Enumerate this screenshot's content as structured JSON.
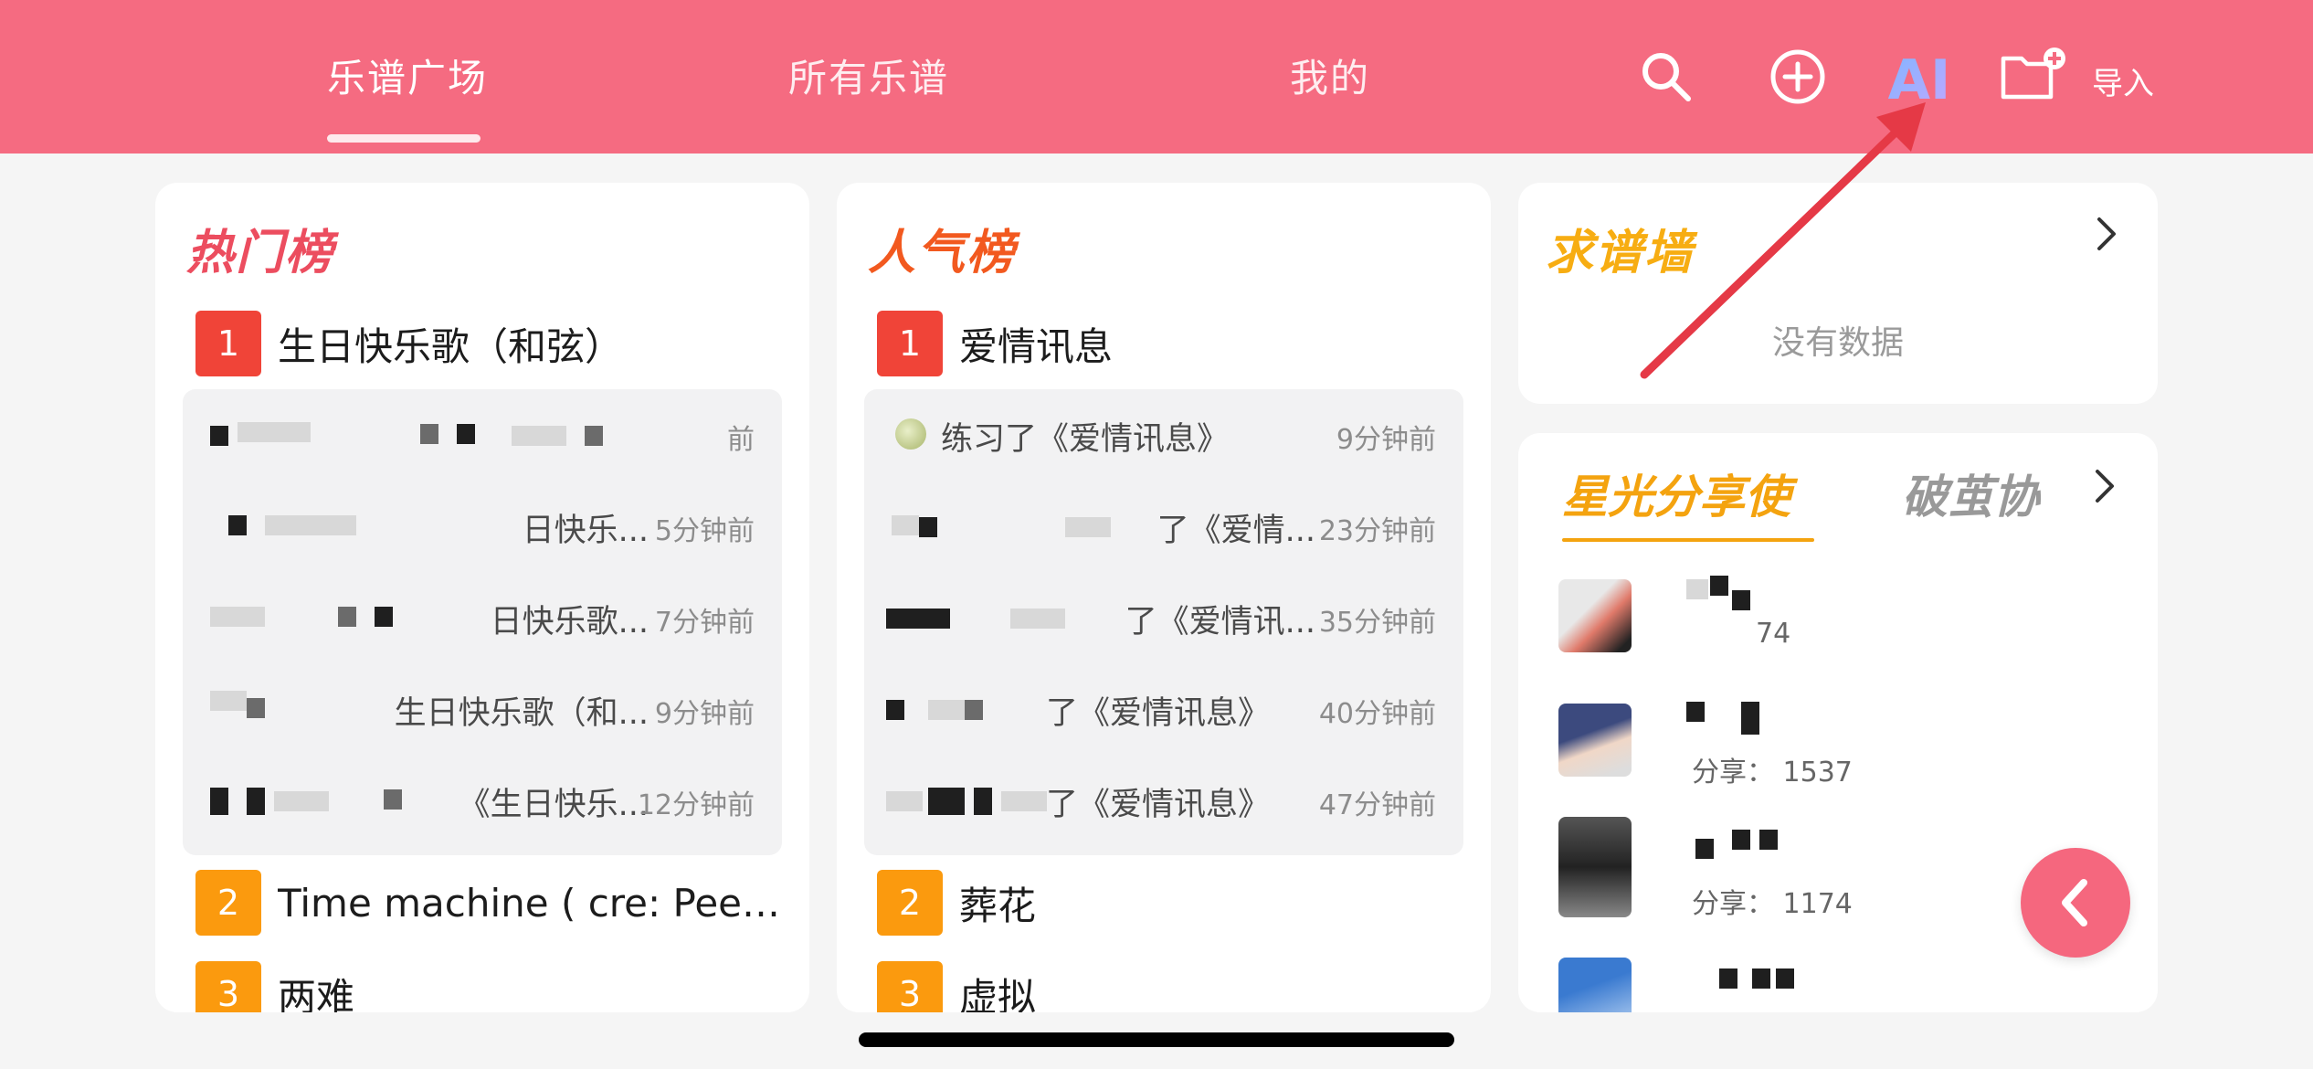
{
  "header": {
    "tabs": [
      {
        "label": "乐谱广场",
        "active": true
      },
      {
        "label": "所有乐谱",
        "active": false
      },
      {
        "label": "我的",
        "active": false
      }
    ],
    "import_label": "导入",
    "ai_label": "AI",
    "colors": {
      "bar": "#f56b81",
      "ai_gradient": [
        "#8ab4ff",
        "#b39cff"
      ]
    }
  },
  "hot_chart": {
    "title": "热门榜",
    "entries": [
      {
        "rank": "1",
        "title": "生日快乐歌（和弦）"
      },
      {
        "rank": "2",
        "title": "Time machine ( cre: Peer..."
      },
      {
        "rank": "3",
        "title": "两难"
      }
    ],
    "activity": [
      {
        "text": "",
        "time": "前"
      },
      {
        "text": "日快乐...",
        "time": "5分钟前"
      },
      {
        "text": "日快乐歌...",
        "time": "7分钟前"
      },
      {
        "text": "生日快乐歌（和...",
        "time": "9分钟前"
      },
      {
        "text": "《生日快乐...",
        "time": "12分钟前"
      }
    ]
  },
  "popular_chart": {
    "title": "人气榜",
    "entries": [
      {
        "rank": "1",
        "title": "爱情讯息"
      },
      {
        "rank": "2",
        "title": "葬花"
      },
      {
        "rank": "3",
        "title": "虚拟"
      }
    ],
    "activity": [
      {
        "text": "练习了《爱情讯息》",
        "time": "9分钟前"
      },
      {
        "text": "了《爱情...",
        "time": "23分钟前"
      },
      {
        "text": "了《爱情讯...",
        "time": "35分钟前"
      },
      {
        "text": "了《爱情讯息》",
        "time": "40分钟前"
      },
      {
        "text": "了《爱情讯息》",
        "time": "47分钟前"
      }
    ]
  },
  "request_wall": {
    "title": "求谱墙",
    "empty_text": "没有数据"
  },
  "share_panel": {
    "tab_active": "星光分享使",
    "tab_inactive": "破茧协",
    "users": [
      {
        "count_text": "74"
      },
      {
        "count_text": "分享： 1537"
      },
      {
        "count_text": "分享： 1174"
      },
      {
        "count_text": ""
      }
    ]
  },
  "icons": [
    "search-icon",
    "add-circle-icon",
    "ai-icon",
    "folder-add-icon",
    "chevron-right-icon",
    "back-arrow-icon",
    "melon-emoji-icon"
  ]
}
